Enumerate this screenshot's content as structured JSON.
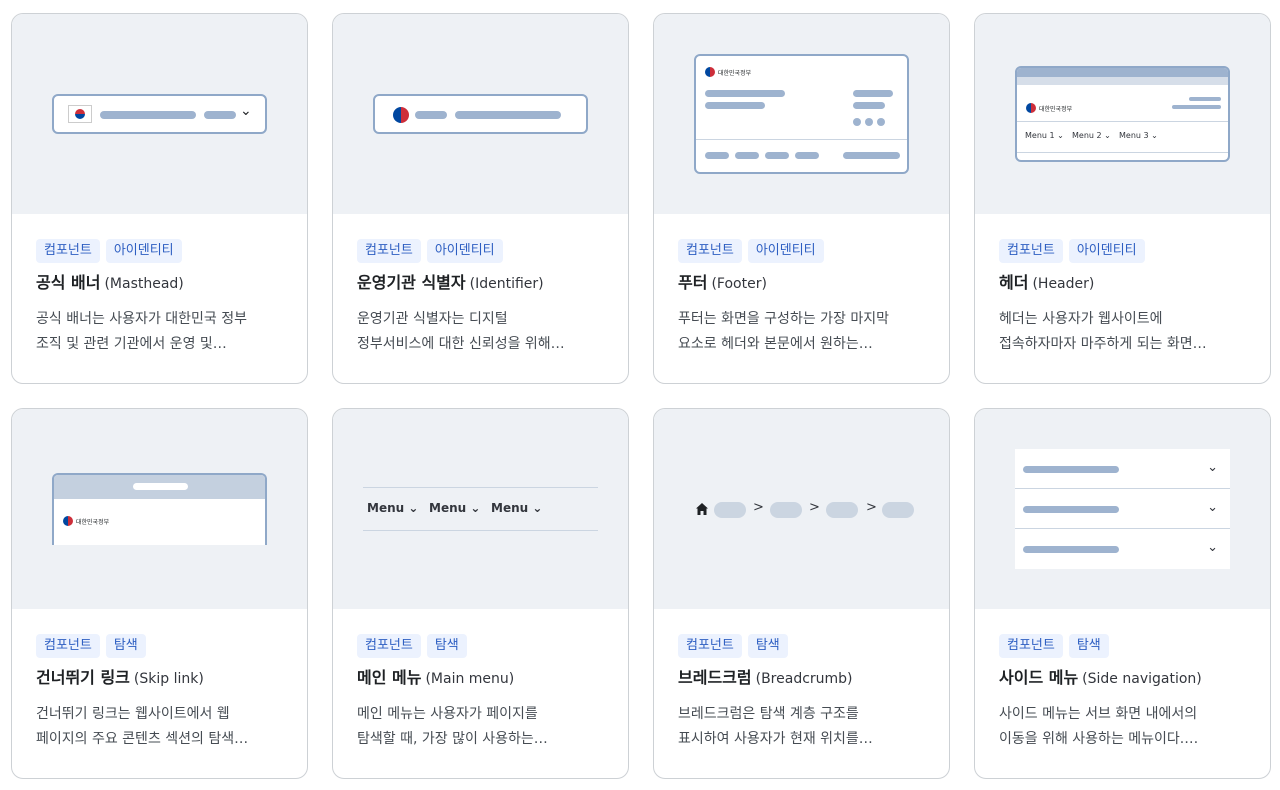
{
  "cards": [
    {
      "tags": [
        "컴포넌트",
        "아이덴티티"
      ],
      "title_ko": "공식 배너",
      "title_en": "(Masthead)",
      "desc": [
        "공식 배너는 사용자가 대한민국 정부",
        "조직 및 관련 기관에서 운영 및…"
      ]
    },
    {
      "tags": [
        "컴포넌트",
        "아이덴티티"
      ],
      "title_ko": "운영기관 식별자",
      "title_en": "(Identifier)",
      "desc": [
        "운영기관 식별자는 디지털",
        "정부서비스에 대한 신뢰성을 위해…"
      ]
    },
    {
      "tags": [
        "컴포넌트",
        "아이덴티티"
      ],
      "title_ko": "푸터",
      "title_en": "(Footer)",
      "desc": [
        "푸터는 화면을 구성하는 가장 마지막",
        "요소로 헤더와 본문에서 원하는…"
      ]
    },
    {
      "tags": [
        "컴포넌트",
        "아이덴티티"
      ],
      "title_ko": "헤더",
      "title_en": "(Header)",
      "desc": [
        "헤더는 사용자가 웹사이트에",
        "접속하자마자 마주하게 되는 화면…"
      ]
    },
    {
      "tags": [
        "컴포넌트",
        "탐색"
      ],
      "title_ko": "건너뛰기 링크",
      "title_en": "(Skip link)",
      "desc": [
        "건너뛰기 링크는 웹사이트에서 웹",
        "페이지의 주요 콘텐츠 섹션의 탐색…"
      ]
    },
    {
      "tags": [
        "컴포넌트",
        "탐색"
      ],
      "title_ko": "메인 메뉴",
      "title_en": "(Main menu)",
      "desc": [
        "메인 메뉴는 사용자가 페이지를",
        "탐색할 때, 가장 많이 사용하는…"
      ]
    },
    {
      "tags": [
        "컴포넌트",
        "탐색"
      ],
      "title_ko": "브레드크럼",
      "title_en": "(Breadcrumb)",
      "desc": [
        "브레드크럼은 탐색 계층 구조를",
        "표시하여 사용자가 현재 위치를…"
      ]
    },
    {
      "tags": [
        "컴포넌트",
        "탐색"
      ],
      "title_ko": "사이드 메뉴",
      "title_en": "(Side navigation)",
      "desc": [
        "사이드 메뉴는 서브 화면 내에서의",
        "이동을 위해 사용하는 메뉴이다.…"
      ]
    }
  ],
  "previews": {
    "gov_logo_text": "대한민국정부",
    "header_menus": [
      "Menu 1",
      "Menu 2",
      "Menu 3"
    ],
    "main_menus": [
      "Menu",
      "Menu",
      "Menu"
    ],
    "breadcrumb_separator": ">",
    "dropdown_glyph": "⌄"
  }
}
